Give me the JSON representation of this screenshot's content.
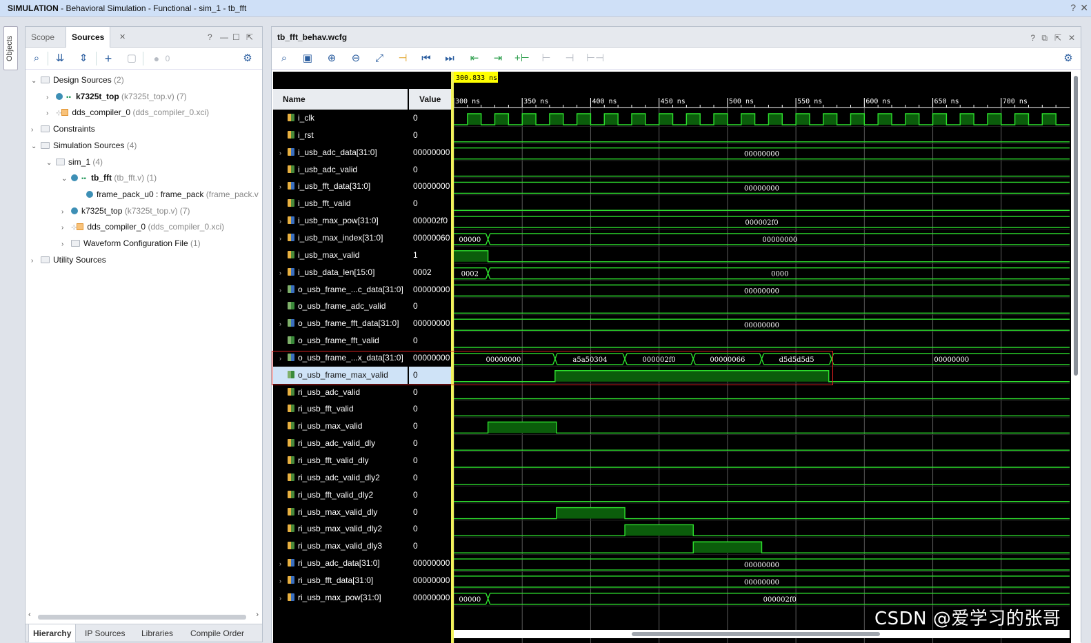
{
  "title": {
    "mode": "SIMULATION",
    "rest": " - Behavioral Simulation - Functional - sim_1 - tb_fft",
    "help": "?",
    "close": "✕"
  },
  "objects_tab": "Objects",
  "left": {
    "tabs": [
      "Scope",
      "Sources"
    ],
    "tab_close": "✕",
    "toolbar_badge": "0",
    "tree": [
      {
        "arrow": "⌄",
        "kind": "folder",
        "label": "Design Sources",
        "count": "(2)",
        "indent": 0
      },
      {
        "arrow": "›",
        "kind": "top",
        "label": "k7325t_top",
        "detail": "(k7325t_top.v) (7)",
        "indent": 1,
        "bold": true
      },
      {
        "arrow": "›",
        "kind": "ip",
        "label": "dds_compiler_0",
        "detail": "(dds_compiler_0.xci)",
        "indent": 1
      },
      {
        "arrow": "›",
        "kind": "folder",
        "label": "Constraints",
        "indent": 0
      },
      {
        "arrow": "⌄",
        "kind": "folder",
        "label": "Simulation Sources",
        "count": "(4)",
        "indent": 0
      },
      {
        "arrow": "⌄",
        "kind": "folder",
        "label": "sim_1",
        "count": "(4)",
        "indent": 1
      },
      {
        "arrow": "⌄",
        "kind": "top",
        "label": "tb_fft",
        "detail": "(tb_fft.v) (1)",
        "indent": 2,
        "bold": true
      },
      {
        "arrow": "",
        "kind": "dot",
        "label": "frame_pack_u0 : frame_pack",
        "detail": "(frame_pack.v",
        "indent": 3
      },
      {
        "arrow": "›",
        "kind": "dot",
        "label": "k7325t_top",
        "detail": "(k7325t_top.v) (7)",
        "indent": 2
      },
      {
        "arrow": "›",
        "kind": "ip",
        "label": "dds_compiler_0",
        "detail": "(dds_compiler_0.xci)",
        "indent": 2
      },
      {
        "arrow": "›",
        "kind": "folder",
        "label": "Waveform Configuration File",
        "count": "(1)",
        "indent": 2
      },
      {
        "arrow": "›",
        "kind": "folder",
        "label": "Utility Sources",
        "indent": 0
      }
    ],
    "bottom_tabs": [
      "Hierarchy",
      "IP Sources",
      "Libraries",
      "Compile Order"
    ]
  },
  "wave": {
    "file": "tb_fft_behav.wcfg",
    "cursor_time": "300.833 ns",
    "name_header": "Name",
    "value_header": "Value",
    "ruler": [
      "300 ns",
      "350 ns",
      "400 ns",
      "450 ns",
      "500 ns",
      "550 ns",
      "600 ns",
      "650 ns",
      "700 ns"
    ],
    "signals": [
      {
        "name": "i_clk",
        "value": "0",
        "icon": "in",
        "expand": false
      },
      {
        "name": "i_rst",
        "value": "0",
        "icon": "in",
        "expand": false
      },
      {
        "name": "i_usb_adc_data[31:0]",
        "value": "00000000",
        "icon": "bus-in",
        "expand": true
      },
      {
        "name": "i_usb_adc_valid",
        "value": "0",
        "icon": "in",
        "expand": false
      },
      {
        "name": "i_usb_fft_data[31:0]",
        "value": "00000000",
        "icon": "bus-in",
        "expand": true
      },
      {
        "name": "i_usb_fft_valid",
        "value": "0",
        "icon": "in",
        "expand": false
      },
      {
        "name": "i_usb_max_pow[31:0]",
        "value": "000002f0",
        "icon": "bus-in",
        "expand": true
      },
      {
        "name": "i_usb_max_index[31:0]",
        "value": "00000060",
        "icon": "bus-in",
        "expand": true
      },
      {
        "name": "i_usb_max_valid",
        "value": "1",
        "icon": "in",
        "expand": false
      },
      {
        "name": "i_usb_data_len[15:0]",
        "value": "0002",
        "icon": "bus-in",
        "expand": true
      },
      {
        "name": "o_usb_frame_...c_data[31:0]",
        "value": "00000000",
        "icon": "bus-out",
        "expand": true
      },
      {
        "name": "o_usb_frame_adc_valid",
        "value": "0",
        "icon": "out",
        "expand": false
      },
      {
        "name": "o_usb_frame_fft_data[31:0]",
        "value": "00000000",
        "icon": "bus-out",
        "expand": true
      },
      {
        "name": "o_usb_frame_fft_valid",
        "value": "0",
        "icon": "out",
        "expand": false
      },
      {
        "name": "o_usb_frame_...x_data[31:0]",
        "value": "00000000",
        "icon": "bus-out",
        "expand": true
      },
      {
        "name": "o_usb_frame_max_valid",
        "value": "0",
        "icon": "out",
        "expand": false,
        "selected": true
      },
      {
        "name": "ri_usb_adc_valid",
        "value": "0",
        "icon": "in",
        "expand": false
      },
      {
        "name": "ri_usb_fft_valid",
        "value": "0",
        "icon": "in",
        "expand": false
      },
      {
        "name": "ri_usb_max_valid",
        "value": "0",
        "icon": "in",
        "expand": false
      },
      {
        "name": "ri_usb_adc_valid_dly",
        "value": "0",
        "icon": "in",
        "expand": false
      },
      {
        "name": "ri_usb_fft_valid_dly",
        "value": "0",
        "icon": "in",
        "expand": false
      },
      {
        "name": "ri_usb_adc_valid_dly2",
        "value": "0",
        "icon": "in",
        "expand": false
      },
      {
        "name": "ri_usb_fft_valid_dly2",
        "value": "0",
        "icon": "in",
        "expand": false
      },
      {
        "name": "ri_usb_max_valid_dly",
        "value": "0",
        "icon": "in",
        "expand": false
      },
      {
        "name": "ri_usb_max_valid_dly2",
        "value": "0",
        "icon": "in",
        "expand": false
      },
      {
        "name": "ri_usb_max_valid_dly3",
        "value": "0",
        "icon": "in",
        "expand": false
      },
      {
        "name": "ri_usb_adc_data[31:0]",
        "value": "00000000",
        "icon": "reg",
        "expand": true
      },
      {
        "name": "ri_usb_fft_data[31:0]",
        "value": "00000000",
        "icon": "reg",
        "expand": true
      },
      {
        "name": "ri_usb_max_pow[31:0]",
        "value": "00000000",
        "icon": "reg",
        "expand": true
      }
    ],
    "traces": [
      {
        "type": "clock",
        "period_ns": 20,
        "first_high_ns": 310
      },
      {
        "type": "level",
        "segs": [
          [
            300,
            750,
            0
          ]
        ]
      },
      {
        "type": "bus",
        "segs": [
          [
            300,
            750,
            "00000000"
          ]
        ]
      },
      {
        "type": "level",
        "segs": [
          [
            300,
            750,
            0
          ]
        ]
      },
      {
        "type": "bus",
        "segs": [
          [
            300,
            750,
            "00000000"
          ]
        ]
      },
      {
        "type": "level",
        "segs": [
          [
            300,
            750,
            0
          ]
        ]
      },
      {
        "type": "bus",
        "segs": [
          [
            300,
            750,
            "000002f0"
          ]
        ]
      },
      {
        "type": "bus",
        "segs": [
          [
            300,
            325,
            "00000"
          ],
          [
            325,
            750,
            "00000000"
          ]
        ]
      },
      {
        "type": "level",
        "segs": [
          [
            300,
            325,
            1
          ],
          [
            325,
            750,
            0
          ]
        ]
      },
      {
        "type": "bus",
        "segs": [
          [
            300,
            325,
            "0002"
          ],
          [
            325,
            750,
            "0000"
          ]
        ]
      },
      {
        "type": "bus",
        "segs": [
          [
            300,
            750,
            "00000000"
          ]
        ]
      },
      {
        "type": "level",
        "segs": [
          [
            300,
            750,
            0
          ]
        ]
      },
      {
        "type": "bus",
        "segs": [
          [
            300,
            750,
            "00000000"
          ]
        ]
      },
      {
        "type": "level",
        "segs": [
          [
            300,
            750,
            0
          ]
        ]
      },
      {
        "type": "bus",
        "segs": [
          [
            300,
            374,
            "00000000"
          ],
          [
            374,
            425,
            "a5a50304"
          ],
          [
            425,
            475,
            "000002f0"
          ],
          [
            475,
            525,
            "00000066"
          ],
          [
            525,
            576,
            "d5d5d5d5"
          ],
          [
            576,
            750,
            "00000000"
          ]
        ]
      },
      {
        "type": "level",
        "segs": [
          [
            300,
            374,
            0
          ],
          [
            374,
            574,
            1
          ],
          [
            574,
            750,
            0
          ]
        ]
      },
      {
        "type": "level",
        "segs": [
          [
            300,
            750,
            0
          ]
        ]
      },
      {
        "type": "level",
        "segs": [
          [
            300,
            750,
            0
          ]
        ]
      },
      {
        "type": "level",
        "segs": [
          [
            300,
            325,
            0
          ],
          [
            325,
            375,
            1
          ],
          [
            375,
            750,
            0
          ]
        ]
      },
      {
        "type": "level",
        "segs": [
          [
            300,
            750,
            0
          ]
        ]
      },
      {
        "type": "level",
        "segs": [
          [
            300,
            750,
            0
          ]
        ]
      },
      {
        "type": "level",
        "segs": [
          [
            300,
            750,
            0
          ]
        ]
      },
      {
        "type": "level",
        "segs": [
          [
            300,
            750,
            0
          ]
        ]
      },
      {
        "type": "level",
        "segs": [
          [
            300,
            375,
            0
          ],
          [
            375,
            425,
            1
          ],
          [
            425,
            750,
            0
          ]
        ]
      },
      {
        "type": "level",
        "segs": [
          [
            300,
            425,
            0
          ],
          [
            425,
            475,
            1
          ],
          [
            475,
            750,
            0
          ]
        ]
      },
      {
        "type": "level",
        "segs": [
          [
            300,
            475,
            0
          ],
          [
            475,
            525,
            1
          ],
          [
            525,
            750,
            0
          ]
        ]
      },
      {
        "type": "bus",
        "segs": [
          [
            300,
            750,
            "00000000"
          ]
        ]
      },
      {
        "type": "bus",
        "segs": [
          [
            300,
            750,
            "00000000"
          ]
        ]
      },
      {
        "type": "bus",
        "segs": [
          [
            300,
            325,
            "00000"
          ],
          [
            325,
            750,
            "000002f0"
          ]
        ]
      }
    ],
    "time_start_ns": 300,
    "time_end_ns": 750,
    "colors": {
      "trace": "#2ee02e",
      "fill": "#0b5d0b",
      "grid": "#5a5a5a",
      "cursor": "#f2f25c"
    }
  },
  "watermark": "CSDN @爱学习的张哥"
}
